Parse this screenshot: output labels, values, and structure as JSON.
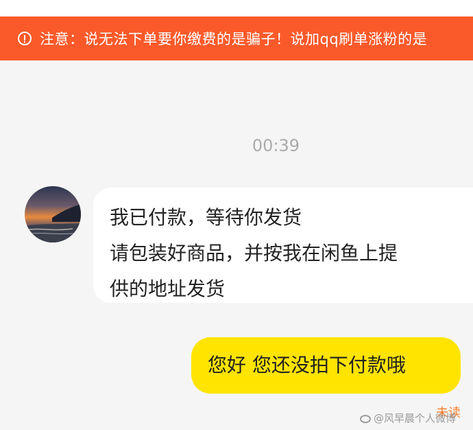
{
  "warning": {
    "text": "注意：说无法下单要你缴费的是骗子！说加qq刷单涨粉的是",
    "color": "#fa5a2a"
  },
  "chat": {
    "timestamp": "00:39",
    "incoming": {
      "lines": [
        "我已付款，等待你发货",
        "请包装好商品，并按我在闲鱼上提",
        "供的地址发货"
      ]
    },
    "outgoing": {
      "text": "您好 您还没拍下付款哦",
      "color": "#ffe400",
      "status": "未读"
    }
  },
  "watermark": "@风早晨个人微博"
}
